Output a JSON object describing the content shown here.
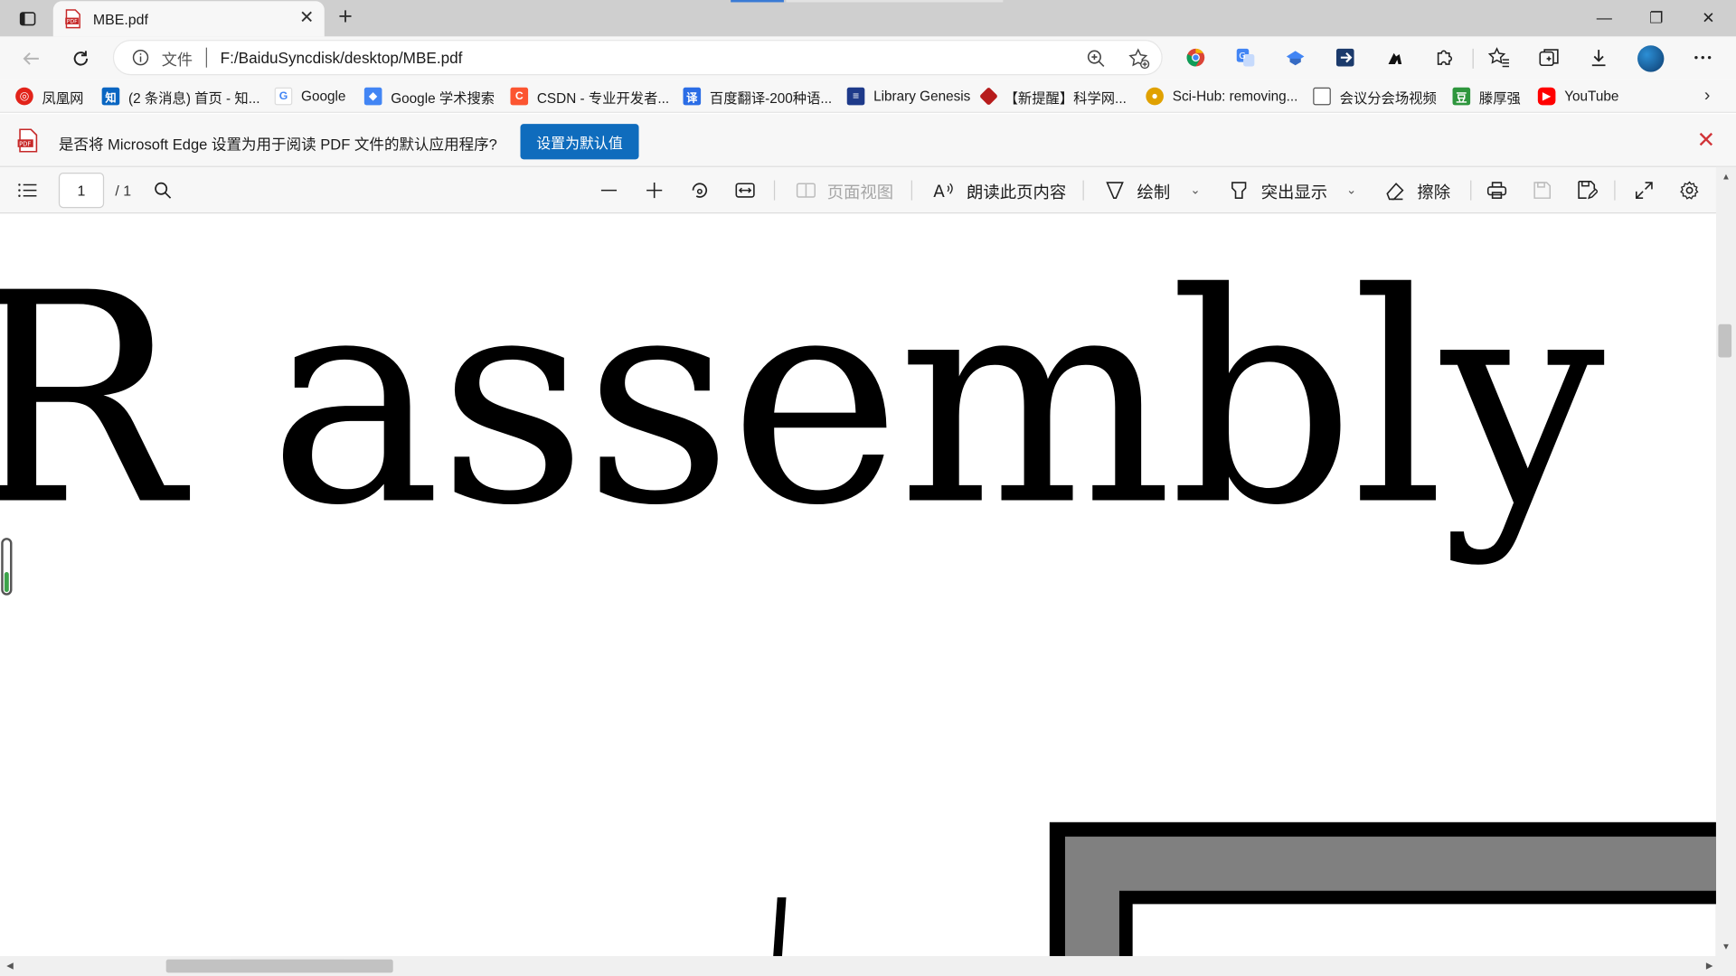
{
  "tab": {
    "title": "MBE.pdf",
    "close": "✕",
    "new": "+"
  },
  "window": {
    "minimize": "—",
    "restore": "❐",
    "close": "✕"
  },
  "address": {
    "scheme_label": "文件",
    "url": "F:/BaiduSyncdisk/desktop/MBE.pdf"
  },
  "favorites": [
    {
      "label": "凤凰网",
      "icon": "phoenix-icon",
      "color": "#e2231a"
    },
    {
      "label": "(2 条消息) 首页 - 知...",
      "icon": "zhihu-icon",
      "color": "#0a66c2"
    },
    {
      "label": "Google",
      "icon": "google-icon",
      "color": "#4285f4"
    },
    {
      "label": "Google 学术搜索",
      "icon": "scholar-icon",
      "color": "#4285f4"
    },
    {
      "label": "CSDN - 专业开发者...",
      "icon": "csdn-icon",
      "color": "#fc5531"
    },
    {
      "label": "百度翻译-200种语...",
      "icon": "baidu-translate-icon",
      "color": "#2b6de6"
    },
    {
      "label": "Library Genesis",
      "icon": "libgen-icon",
      "color": "#1e3a8a"
    },
    {
      "label": "【新提醒】科学网...",
      "icon": "sciencenet-icon",
      "color": "#b71c1c"
    },
    {
      "label": "Sci-Hub: removing...",
      "icon": "scihub-icon",
      "color": "#e0a100"
    },
    {
      "label": "会议分会场视频",
      "icon": "page-icon",
      "color": "#555555"
    },
    {
      "label": "滕厚强",
      "icon": "douban-icon",
      "color": "#2e963d"
    },
    {
      "label": "YouTube",
      "icon": "youtube-icon",
      "color": "#ff0000"
    }
  ],
  "banner": {
    "text": "是否将 Microsoft Edge 设置为用于阅读 PDF 文件的默认应用程序?",
    "button": "设置为默认值",
    "close": "✕"
  },
  "pdf_toolbar": {
    "page_current": "1",
    "page_total": "/ 1",
    "page_view": "页面视图",
    "read_aloud": "朗读此页内容",
    "draw": "绘制",
    "highlight": "突出显示",
    "erase": "擦除"
  },
  "document": {
    "visible_text": "R assembly"
  },
  "colors": {
    "accent": "#0f6cbd",
    "banner_close": "#d13438",
    "frame_gray": "#808080"
  }
}
